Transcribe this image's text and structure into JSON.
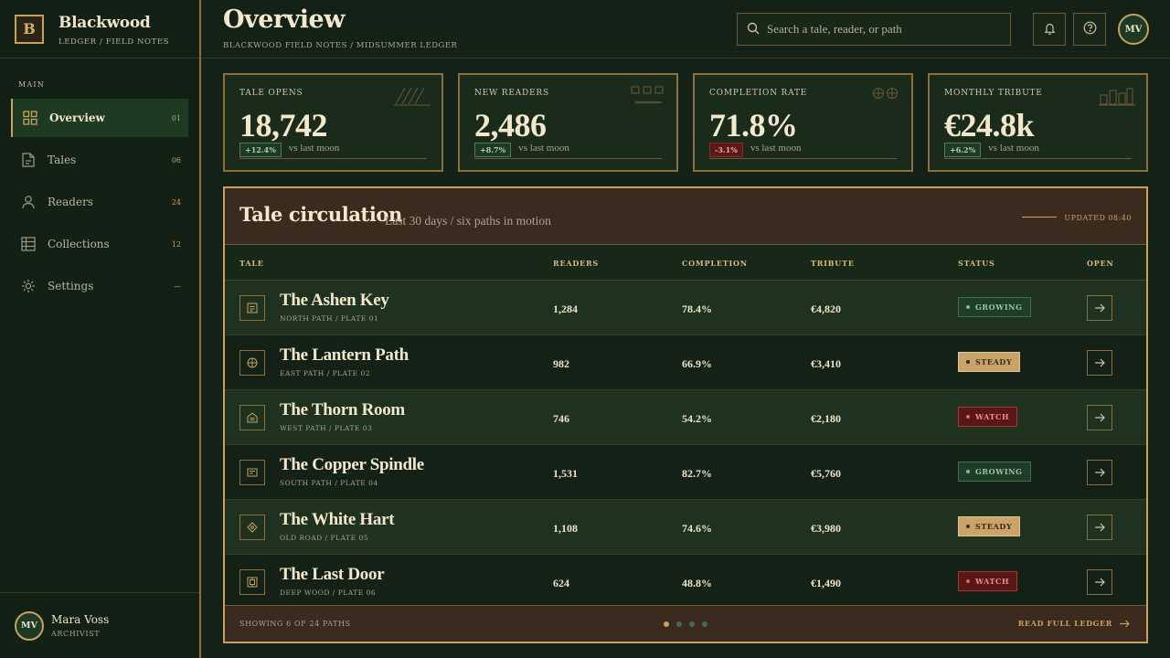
{
  "brand": {
    "mark": "B",
    "name": "Blackwood",
    "sub": "LEDGER / FIELD NOTES"
  },
  "sidebar": {
    "section": "MAIN",
    "items": [
      {
        "label": "Overview",
        "count": "01",
        "icon": "grid-icon"
      },
      {
        "label": "Tales",
        "count": "06",
        "icon": "document-icon"
      },
      {
        "label": "Readers",
        "count": "24",
        "icon": "user-icon"
      },
      {
        "label": "Collections",
        "count": "12",
        "icon": "table-icon"
      },
      {
        "label": "Settings",
        "count": "—",
        "icon": "gear-icon"
      }
    ]
  },
  "user": {
    "initials": "MV",
    "name": "Mara Voss",
    "role": "ARCHIVIST"
  },
  "header": {
    "title": "Overview",
    "breadcrumb": "BLACKWOOD FIELD NOTES / MIDSUMMER LEDGER",
    "search_placeholder": "Search a tale, reader, or path",
    "avatar": "MV"
  },
  "kpis": [
    {
      "label": "TALE OPENS",
      "value": "18,742",
      "delta": "+12.4%",
      "trend": "up",
      "note": "vs last moon"
    },
    {
      "label": "NEW READERS",
      "value": "2,486",
      "delta": "+8.7%",
      "trend": "up",
      "note": "vs last moon"
    },
    {
      "label": "COMPLETION RATE",
      "value": "71.8%",
      "delta": "-3.1%",
      "trend": "down",
      "note": "vs last moon"
    },
    {
      "label": "MONTHLY TRIBUTE",
      "value": "€24.8k",
      "delta": "+6.2%",
      "trend": "up",
      "note": "vs last moon"
    }
  ],
  "table": {
    "title": "Tale circulation",
    "subtitle": "Last 30 days / six paths in motion",
    "updated": "UPDATED 08:40",
    "columns": {
      "tale": "TALE",
      "readers": "READERS",
      "completion": "COMPLETION",
      "tribute": "TRIBUTE",
      "status": "STATUS",
      "open": "OPEN"
    },
    "rows": [
      {
        "name": "The Ashen Key",
        "path": "NORTH PATH / PLATE 01",
        "readers": "1,284",
        "completion": "78.4%",
        "tribute": "€4,820",
        "status": "GROWING",
        "icon": "page-icon"
      },
      {
        "name": "The Lantern Path",
        "path": "EAST PATH / PLATE 02",
        "readers": "982",
        "completion": "66.9%",
        "tribute": "€3,410",
        "status": "STEADY",
        "icon": "compass-icon"
      },
      {
        "name": "The Thorn Room",
        "path": "WEST PATH / PLATE 03",
        "readers": "746",
        "completion": "54.2%",
        "tribute": "€2,180",
        "status": "WATCH",
        "icon": "house-icon"
      },
      {
        "name": "The Copper Spindle",
        "path": "SOUTH PATH / PLATE 04",
        "readers": "1,531",
        "completion": "82.7%",
        "tribute": "€5,760",
        "status": "GROWING",
        "icon": "list-icon"
      },
      {
        "name": "The White Hart",
        "path": "OLD ROAD / PLATE 05",
        "readers": "1,108",
        "completion": "74.6%",
        "tribute": "€3,980",
        "status": "STEADY",
        "icon": "diamond-icon"
      },
      {
        "name": "The Last Door",
        "path": "DEEP WOOD / PLATE 06",
        "readers": "624",
        "completion": "48.8%",
        "tribute": "€1,490",
        "status": "WATCH",
        "icon": "door-icon"
      }
    ],
    "footer": {
      "showing": "SHOWING 6 OF 24 PATHS",
      "link": "READ FULL LEDGER",
      "pages": 4,
      "current_page": 1
    }
  },
  "colors": {
    "accent": "#c9a15f",
    "background": "#142116",
    "panel": "#3b2a1e",
    "growing": "#3f7049",
    "steady": "#c9a46a",
    "watch": "#a73730"
  }
}
